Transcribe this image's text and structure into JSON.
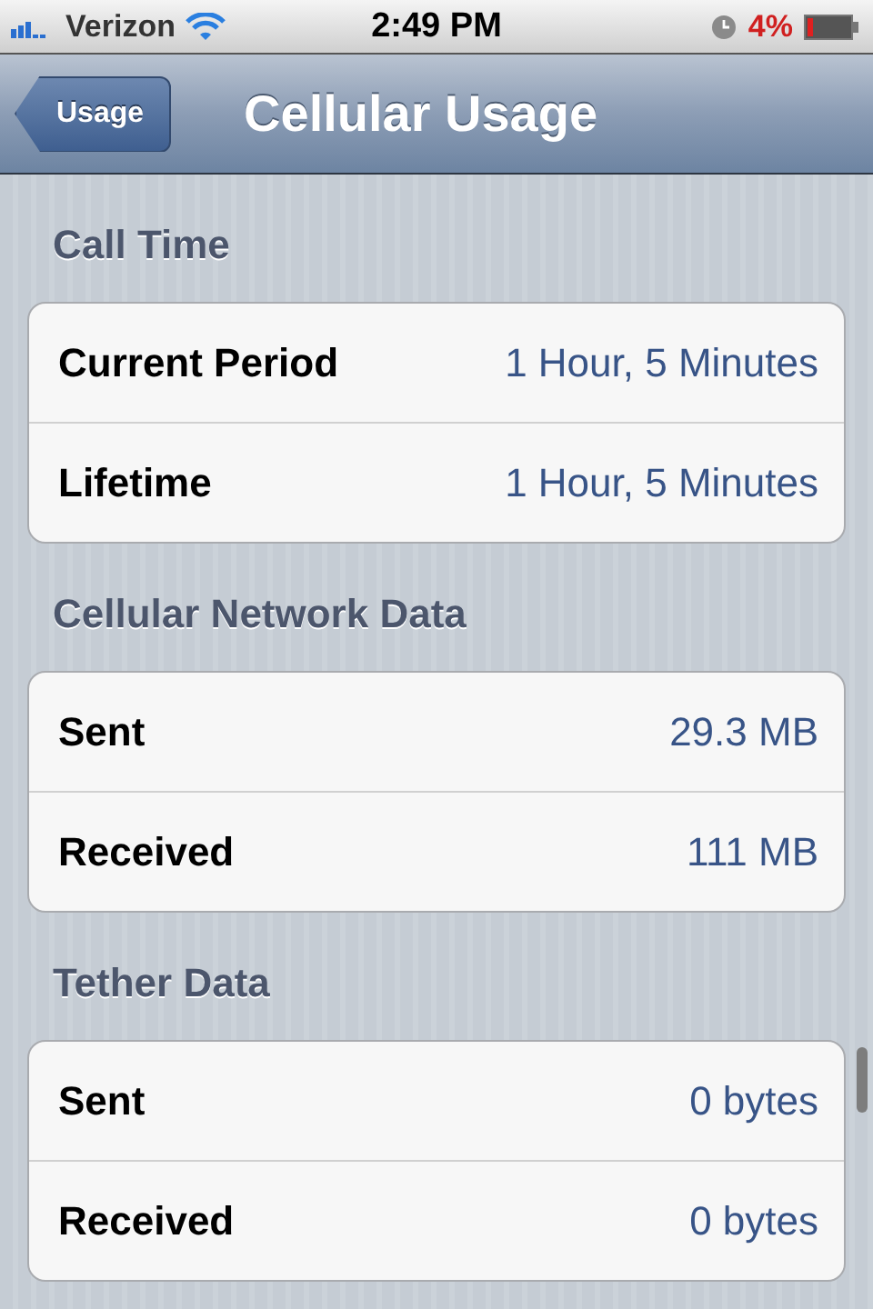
{
  "status_bar": {
    "carrier": "Verizon",
    "time": "2:49 PM",
    "battery": "4%"
  },
  "nav_bar": {
    "back": "Usage",
    "title": "Cellular Usage"
  },
  "sections": [
    {
      "header": "Call Time",
      "rows": [
        {
          "label": "Current Period",
          "value": "1 Hour, 5 Minutes"
        },
        {
          "label": "Lifetime",
          "value": "1 Hour, 5 Minutes"
        }
      ]
    },
    {
      "header": "Cellular Network Data",
      "rows": [
        {
          "label": "Sent",
          "value": "29.3 MB"
        },
        {
          "label": "Received",
          "value": "111 MB"
        }
      ]
    },
    {
      "header": "Tether Data",
      "rows": [
        {
          "label": "Sent",
          "value": "0 bytes"
        },
        {
          "label": "Received",
          "value": "0 bytes"
        }
      ]
    }
  ]
}
